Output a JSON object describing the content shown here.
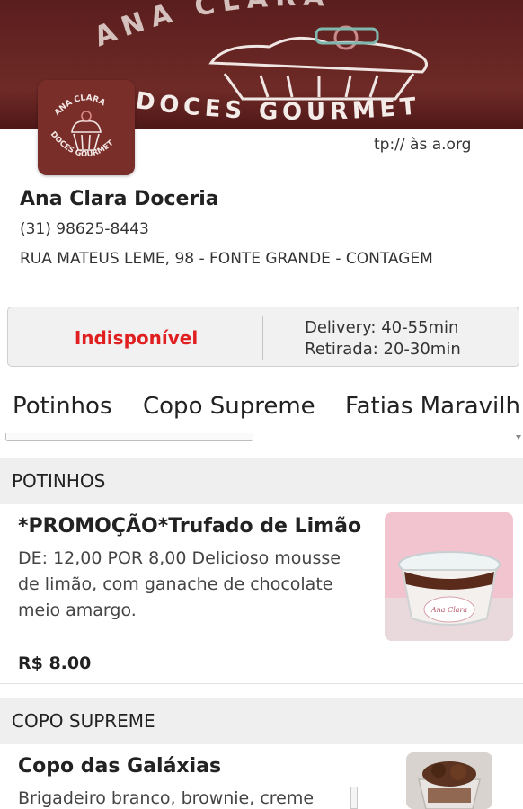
{
  "banner": {
    "brand_line1": "ANA CLARA",
    "brand_line2": "DOCES GOURMET"
  },
  "logo": {
    "line1": "ANA CLARA",
    "line2": "DOCES GOURMET"
  },
  "site_url": "tp:// às a.org",
  "store": {
    "name": "Ana Clara Doceria",
    "phone": "(31) 98625-8443",
    "address": "RUA MATEUS LEME, 98 - FONTE GRANDE - CONTAGEM"
  },
  "status": {
    "availability": "Indisponível",
    "delivery": "Delivery: 40-55min",
    "pickup": "Retirada: 20-30min"
  },
  "categories": [
    "Potinhos",
    "Copo Supreme",
    "Fatias Maravilh"
  ],
  "sections": [
    {
      "title": "POTINHOS",
      "product": {
        "name": "*PROMOÇÃO*Trufado de Limão",
        "description": "DE: 12,00 POR 8,00 Delicioso mousse de limão, com ganache de chocolate meio amargo.",
        "price": "R$ 8.00",
        "image_label": "Ana Clara"
      }
    },
    {
      "title": "COPO SUPREME",
      "product": {
        "name": "Copo das Galáxias",
        "description": "Brigadeiro branco, brownie, creme"
      }
    }
  ],
  "colors": {
    "brand": "#6e2a26",
    "unavailable": "#e02020"
  }
}
